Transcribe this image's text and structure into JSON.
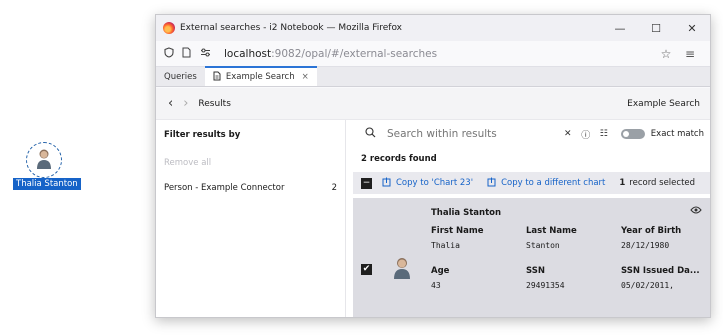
{
  "desktop": {
    "entity_label": "Thalia Stanton"
  },
  "browser": {
    "window_title": "External searches - i2 Notebook — Mozilla Firefox",
    "controls": {
      "minimize": "—",
      "maximize": "☐",
      "close": "✕"
    },
    "url_host": "localhost",
    "url_rest": ":9082/opal/#/external-searches",
    "tabs": [
      {
        "label": "Queries"
      },
      {
        "label": "Example Search",
        "close": "×"
      }
    ]
  },
  "breadcrumb": {
    "back": "‹",
    "forward": "›",
    "title": "Results",
    "right": "Example Search"
  },
  "filters": {
    "title": "Filter results by",
    "remove_all": "Remove all",
    "facets": [
      {
        "label": "Person - Example Connector",
        "count": "2"
      }
    ]
  },
  "search": {
    "placeholder": "Search within results",
    "clear": "✕",
    "info": "ⓘ",
    "options": "☷",
    "exact_match": "Exact match"
  },
  "results": {
    "count_label": "2 records found",
    "copy_to_chart": "Copy to 'Chart 23'",
    "copy_to_different": "Copy to a different chart",
    "selected_count": "1",
    "selected_text": "record selected",
    "record": {
      "title": "Thalia Stanton",
      "fields": [
        {
          "label": "First Name",
          "value": "Thalia"
        },
        {
          "label": "Last Name",
          "value": "Stanton"
        },
        {
          "label": "Year of Birth",
          "value": "28/12/1980"
        },
        {
          "label": "Age",
          "value": "43"
        },
        {
          "label": "SSN",
          "value": "29491354"
        },
        {
          "label": "SSN Issued Da...",
          "value": "05/02/2011,"
        }
      ]
    }
  },
  "colors": {
    "accent": "#1663c8",
    "selected_row": "#dcdce2"
  }
}
